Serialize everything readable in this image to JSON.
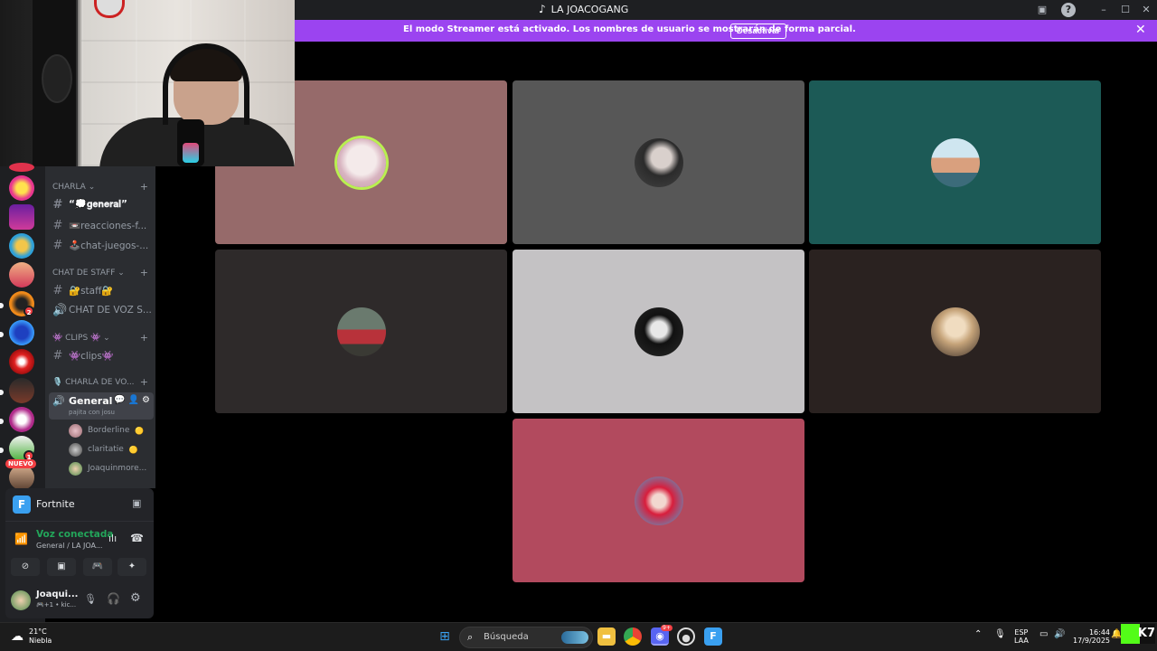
{
  "window": {
    "title": "LA JOACOGANG",
    "controls": [
      "minimize",
      "maximize",
      "close"
    ]
  },
  "banner": {
    "text": "El modo Streamer está activado. Los nombres de usuario se mostrarán de forma parcial.",
    "button_label": "Desactivar"
  },
  "sidebar": {
    "categories": {
      "charla": "CHARLA",
      "staff": "CHAT DE STAFF",
      "clips": "👾 CLIPS 👾",
      "voz": "🎙️ CHARLA DE VO..."
    },
    "channels": {
      "general_text": "“💭𝐠𝐞𝐧𝐞𝐫𝐚𝐥”",
      "reacciones": "📼reacciones-f...",
      "juegos": "🕹️chat-juegos-...",
      "staff": "🔐staff🔐",
      "staff_voice": "CHAT DE VOZ S...",
      "clips": "👾clips👾"
    },
    "voice_channel": {
      "name": "General",
      "status": "pajita con josu"
    },
    "voice_users": [
      "Borderline",
      "claritatie",
      "Joaquinmore..."
    ],
    "new_badge": "NUEVO"
  },
  "server_badges": {
    "server6": "2",
    "server15": "1"
  },
  "activity": {
    "game": "Fortnite"
  },
  "voice_panel": {
    "status": "Voz conectada",
    "channel": "General / LA JOA..."
  },
  "user_panel": {
    "name": "Joaqui...",
    "status": "🎮+1 • kic..."
  },
  "stage": {
    "tiles": [
      {
        "name": "tile-1",
        "bg": "#966a6a",
        "speaking": true
      },
      {
        "name": "tile-2",
        "bg": "#575757",
        "speaking": false
      },
      {
        "name": "tile-3",
        "bg": "#1c5a56",
        "speaking": false
      },
      {
        "name": "tile-4",
        "bg": "#2e2a2a",
        "speaking": false
      },
      {
        "name": "tile-5",
        "bg": "#c4c2c4",
        "speaking": false
      },
      {
        "name": "tile-6",
        "bg": "#2a2220",
        "speaking": false
      },
      {
        "name": "tile-7",
        "bg": "#b24a5e",
        "speaking": false
      }
    ]
  },
  "taskbar": {
    "weather_temp": "21°C",
    "weather_desc": "Niebla",
    "search_placeholder": "Búsqueda",
    "discord_badge": "9+",
    "lang_1": "ESP",
    "lang_2": "LAA",
    "time": "16:44",
    "date": "17/9/2025"
  },
  "colors": {
    "banner": "#9b44f0",
    "voice_green": "#23a55a",
    "speaking_ring": "#b9f050"
  }
}
